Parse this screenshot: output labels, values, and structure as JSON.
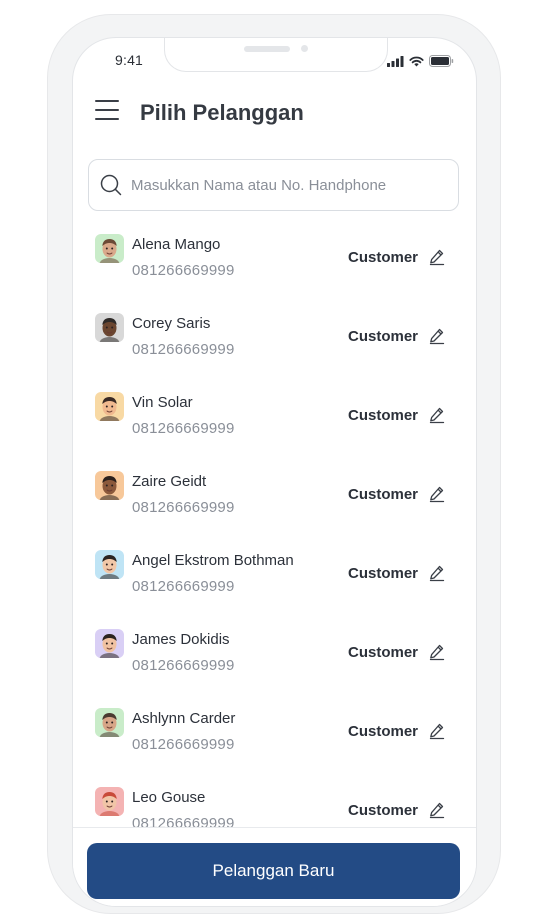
{
  "status_bar": {
    "time": "9:41"
  },
  "header": {
    "title": "Pilih Pelanggan"
  },
  "search": {
    "placeholder": "Masukkan Nama atau No. Handphone"
  },
  "customers": [
    {
      "name": "Alena Mango",
      "phone": "081266669999",
      "role": "Customer",
      "avatar_bg": "#c9ecc9",
      "skin": "#d9a98b",
      "hair": "#6b4a36"
    },
    {
      "name": "Corey Saris",
      "phone": "081266669999",
      "role": "Customer",
      "avatar_bg": "#d8d8d8",
      "skin": "#6b4630",
      "hair": "#2e2a28"
    },
    {
      "name": "Vin Solar",
      "phone": "081266669999",
      "role": "Customer",
      "avatar_bg": "#f8d9a4",
      "skin": "#f0b98f",
      "hair": "#3a2a24"
    },
    {
      "name": "Zaire Geidt",
      "phone": "081266669999",
      "role": "Customer",
      "avatar_bg": "#f7c89a",
      "skin": "#8c5a3c",
      "hair": "#2b201c"
    },
    {
      "name": "Angel Ekstrom Bothman",
      "phone": "081266669999",
      "role": "Customer",
      "avatar_bg": "#bfe4f5",
      "skin": "#f1c7a8",
      "hair": "#2a2422"
    },
    {
      "name": "James Dokidis",
      "phone": "081266669999",
      "role": "Customer",
      "avatar_bg": "#d9cff5",
      "skin": "#f0c2a2",
      "hair": "#2c2420"
    },
    {
      "name": "Ashlynn Carder",
      "phone": "081266669999",
      "role": "Customer",
      "avatar_bg": "#c9ecc9",
      "skin": "#d7a688",
      "hair": "#4a3a30"
    },
    {
      "name": "Leo Gouse",
      "phone": "081266669999",
      "role": "Customer",
      "avatar_bg": "#f4b3b3",
      "skin": "#f1c5a7",
      "hair": "#c84a3a"
    }
  ],
  "icons": {
    "menu": "hamburger-icon",
    "search": "search-icon",
    "edit": "pencil-icon"
  },
  "footer": {
    "new_customer_label": "Pelanggan Baru"
  },
  "colors": {
    "primary": "#234b85",
    "text": "#2c313a",
    "muted": "#8a8f98"
  }
}
